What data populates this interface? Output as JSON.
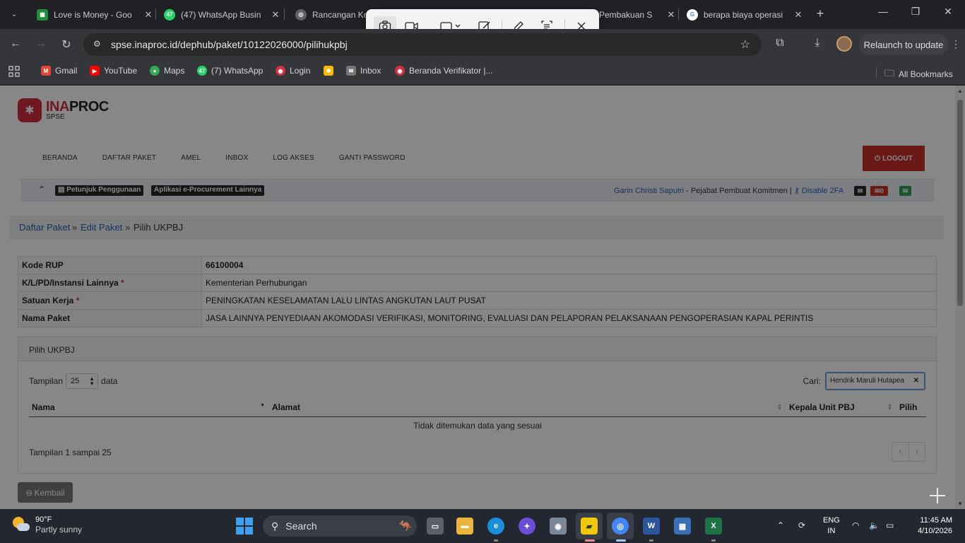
{
  "browser": {
    "tabs": [
      {
        "title": "Love is Money - Goo",
        "favicon": "sheets-icon",
        "color": "#1e8e3e",
        "glyph": "▦"
      },
      {
        "title": "(47) WhatsApp Busin",
        "favicon": "whatsapp-icon",
        "color": "#25d366",
        "glyph": "47"
      },
      {
        "title": "Rancangan Ko",
        "favicon": "globe-icon",
        "color": "#5f6368",
        "glyph": "◎"
      },
      {
        "title": "Pembakuan S",
        "favicon": "globe-icon",
        "color": "#5f6368",
        "glyph": "◎"
      },
      {
        "title": "berapa biaya operasi",
        "favicon": "google-icon",
        "color": "#4285f4",
        "glyph": "G"
      }
    ],
    "url": "spse.inaproc.id/dephub/paket/10122026000/pilihukpbj",
    "relaunch_label": "Relaunch to update",
    "bookmarks": [
      {
        "label": "Gmail",
        "icon": "gmail-icon",
        "color": "#ea4335",
        "glyph": "M"
      },
      {
        "label": "YouTube",
        "icon": "youtube-icon",
        "color": "#ff0000",
        "glyph": "▶"
      },
      {
        "label": "Maps",
        "icon": "maps-icon",
        "color": "#34a853",
        "glyph": "●"
      },
      {
        "label": "(7) WhatsApp",
        "icon": "whatsapp-icon",
        "color": "#25d366",
        "glyph": "47"
      },
      {
        "label": "Login",
        "icon": "login-icon",
        "color": "#d32f3f",
        "glyph": "◉"
      },
      {
        "label": "",
        "icon": "photos-icon",
        "color": "#fbbc05",
        "glyph": "✱"
      },
      {
        "label": "Inbox",
        "icon": "mail-icon",
        "color": "#777777",
        "glyph": "✉"
      },
      {
        "label": "Beranda Verifikator |...",
        "icon": "globe-icon",
        "color": "#d32f3f",
        "glyph": "◉"
      }
    ],
    "all_bookmarks_label": "All Bookmarks"
  },
  "page": {
    "logo": {
      "ina": "INA",
      "proc": "PROC",
      "sub": "SPSE"
    },
    "nav": [
      "BERANDA",
      "DAFTAR PAKET",
      "AMEL",
      "INBOX",
      "LOG AKSES",
      "GANTI PASSWORD"
    ],
    "logout_label": "LOGOUT",
    "infobar": {
      "petunjuk": "Petunjuk Penggunaan",
      "aplikasi": "Aplikasi e-Procurement Lainnya",
      "user_name": "Garin Christi Saputri",
      "user_role": " - Pejabat Pembuat Komitmen | ",
      "disable_2fa": "Disable 2FA",
      "mail_count": "0"
    },
    "breadcrumb": {
      "item1": "Daftar Paket",
      "item2": "Edit Paket",
      "current": "Pilih UKPBJ",
      "sep": "»"
    },
    "details": [
      {
        "label": "Kode RUP",
        "required": false,
        "value": "66100004",
        "bold": true
      },
      {
        "label": "K/L/PD/Instansi Lainnya",
        "required": true,
        "value": "Kementerian Perhubungan",
        "bold": false
      },
      {
        "label": "Satuan Kerja",
        "required": true,
        "value": "PENINGKATAN KESELAMATAN LALU LINTAS ANGKUTAN LAUT PUSAT",
        "bold": false
      },
      {
        "label": "Nama Paket",
        "required": false,
        "value": "JASA LAINNYA PENYEDIAAN AKOMODASI VERIFIKASI, MONITORING, EVALUASI DAN PELAPORAN PELAKSANAAN PENGOPERASIAN KAPAL PERINTIS",
        "bold": false
      }
    ],
    "panel": {
      "title": "Pilih UKPBJ",
      "show_label": "Tampilan",
      "show_value": "25",
      "show_suffix": "data",
      "search_label": "Cari:",
      "search_value": "Hendrik Maruli Hutapea",
      "columns": [
        "Nama",
        "Alamat",
        "Kepala Unit PBJ",
        "Pilih"
      ],
      "empty_text": "Tidak ditemukan data yang sesuai",
      "info_text": "Tampilan 1 sampai 25",
      "prev": "‹",
      "next": "›"
    },
    "back_label": "Kembali"
  },
  "taskbar": {
    "temp": "90°F",
    "weather": "Partly sunny",
    "search_label": "Search",
    "lang_1": "ENG",
    "lang_2": "IN",
    "time": "11:45 AM",
    "date": "4/10/2026"
  }
}
